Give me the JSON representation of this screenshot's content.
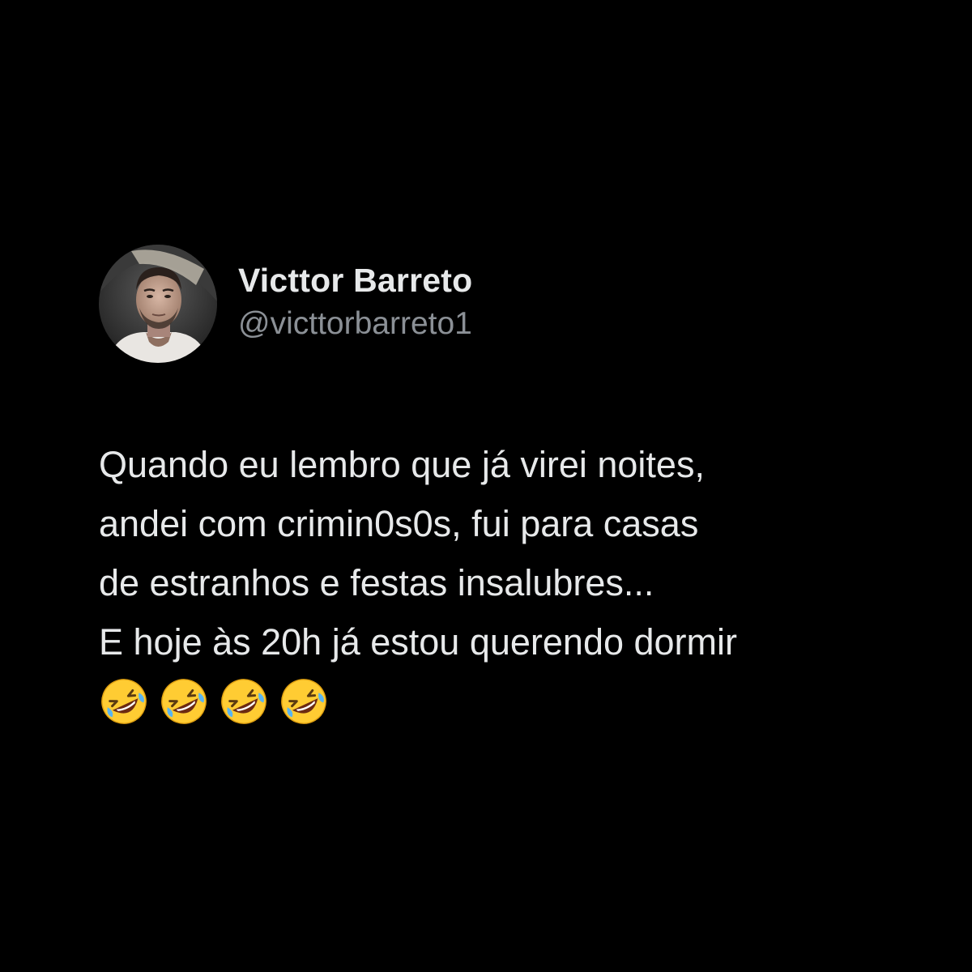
{
  "author": {
    "display_name": "Victtor Barreto",
    "handle": "@victtorbarreto1",
    "avatar_icon": "profile-photo"
  },
  "tweet": {
    "lines": [
      "Quando eu lembro que já virei noites,",
      "andei com crimin0s0s, fui para casas",
      "de estranhos e festas insalubres...",
      "E hoje às 20h já estou querendo dormir"
    ],
    "emojis": [
      "rolling-on-floor-laughing",
      "rolling-on-floor-laughing",
      "rolling-on-floor-laughing",
      "rolling-on-floor-laughing"
    ]
  },
  "colors": {
    "background": "#000000",
    "text_primary": "#e7e9ea",
    "text_secondary": "#8b9096",
    "emoji_face": "#ffcc33"
  }
}
